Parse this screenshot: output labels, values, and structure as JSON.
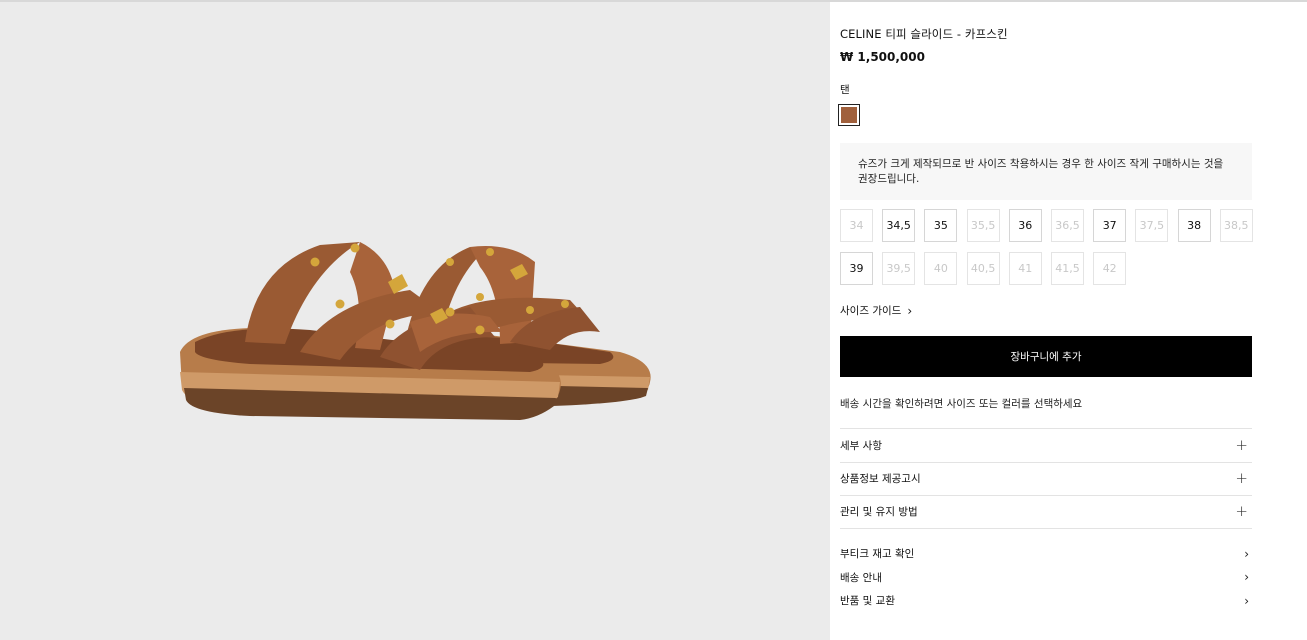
{
  "product": {
    "title": "CELINE 티피 슬라이드 - 카프스킨",
    "price": "₩ 1,500,000",
    "color_label": "탠",
    "swatch_color": "#a0603c"
  },
  "notice": "슈즈가 크게 제작되므로 반 사이즈 착용하시는 경우 한 사이즈 작게 구매하시는 것을 권장드립니다.",
  "sizes": [
    {
      "label": "34",
      "available": false
    },
    {
      "label": "34,5",
      "available": true
    },
    {
      "label": "35",
      "available": true
    },
    {
      "label": "35,5",
      "available": false
    },
    {
      "label": "36",
      "available": true
    },
    {
      "label": "36,5",
      "available": false
    },
    {
      "label": "37",
      "available": true
    },
    {
      "label": "37,5",
      "available": false
    },
    {
      "label": "38",
      "available": true
    },
    {
      "label": "38,5",
      "available": false
    },
    {
      "label": "39",
      "available": true
    },
    {
      "label": "39,5",
      "available": false
    },
    {
      "label": "40",
      "available": false
    },
    {
      "label": "40,5",
      "available": false
    },
    {
      "label": "41",
      "available": false
    },
    {
      "label": "41,5",
      "available": false
    },
    {
      "label": "42",
      "available": false
    }
  ],
  "size_guide": {
    "label": "사이즈 가이드",
    "icon": "chevron-right-icon"
  },
  "cart_button": "장바구니에 추가",
  "delivery_note": "배송 시간을 확인하려면 사이즈 또는 컬러를 선택하세요",
  "accordion": [
    {
      "label": "세부 사항",
      "icon": "plus-icon"
    },
    {
      "label": "상품정보 제공고시",
      "icon": "plus-icon"
    },
    {
      "label": "관리 및 유지 방법",
      "icon": "plus-icon"
    }
  ],
  "links": [
    {
      "label": "부티크 재고 확인",
      "icon": "chevron-right-icon"
    },
    {
      "label": "배송 안내",
      "icon": "chevron-right-icon"
    },
    {
      "label": "반품 및 교환",
      "icon": "chevron-right-icon"
    }
  ],
  "colors": {
    "image_bg": "#ebebeb",
    "cart_bg": "#000000",
    "notice_bg": "#f7f7f7",
    "leather": "#9a5a33",
    "sole": "#c9915e"
  }
}
